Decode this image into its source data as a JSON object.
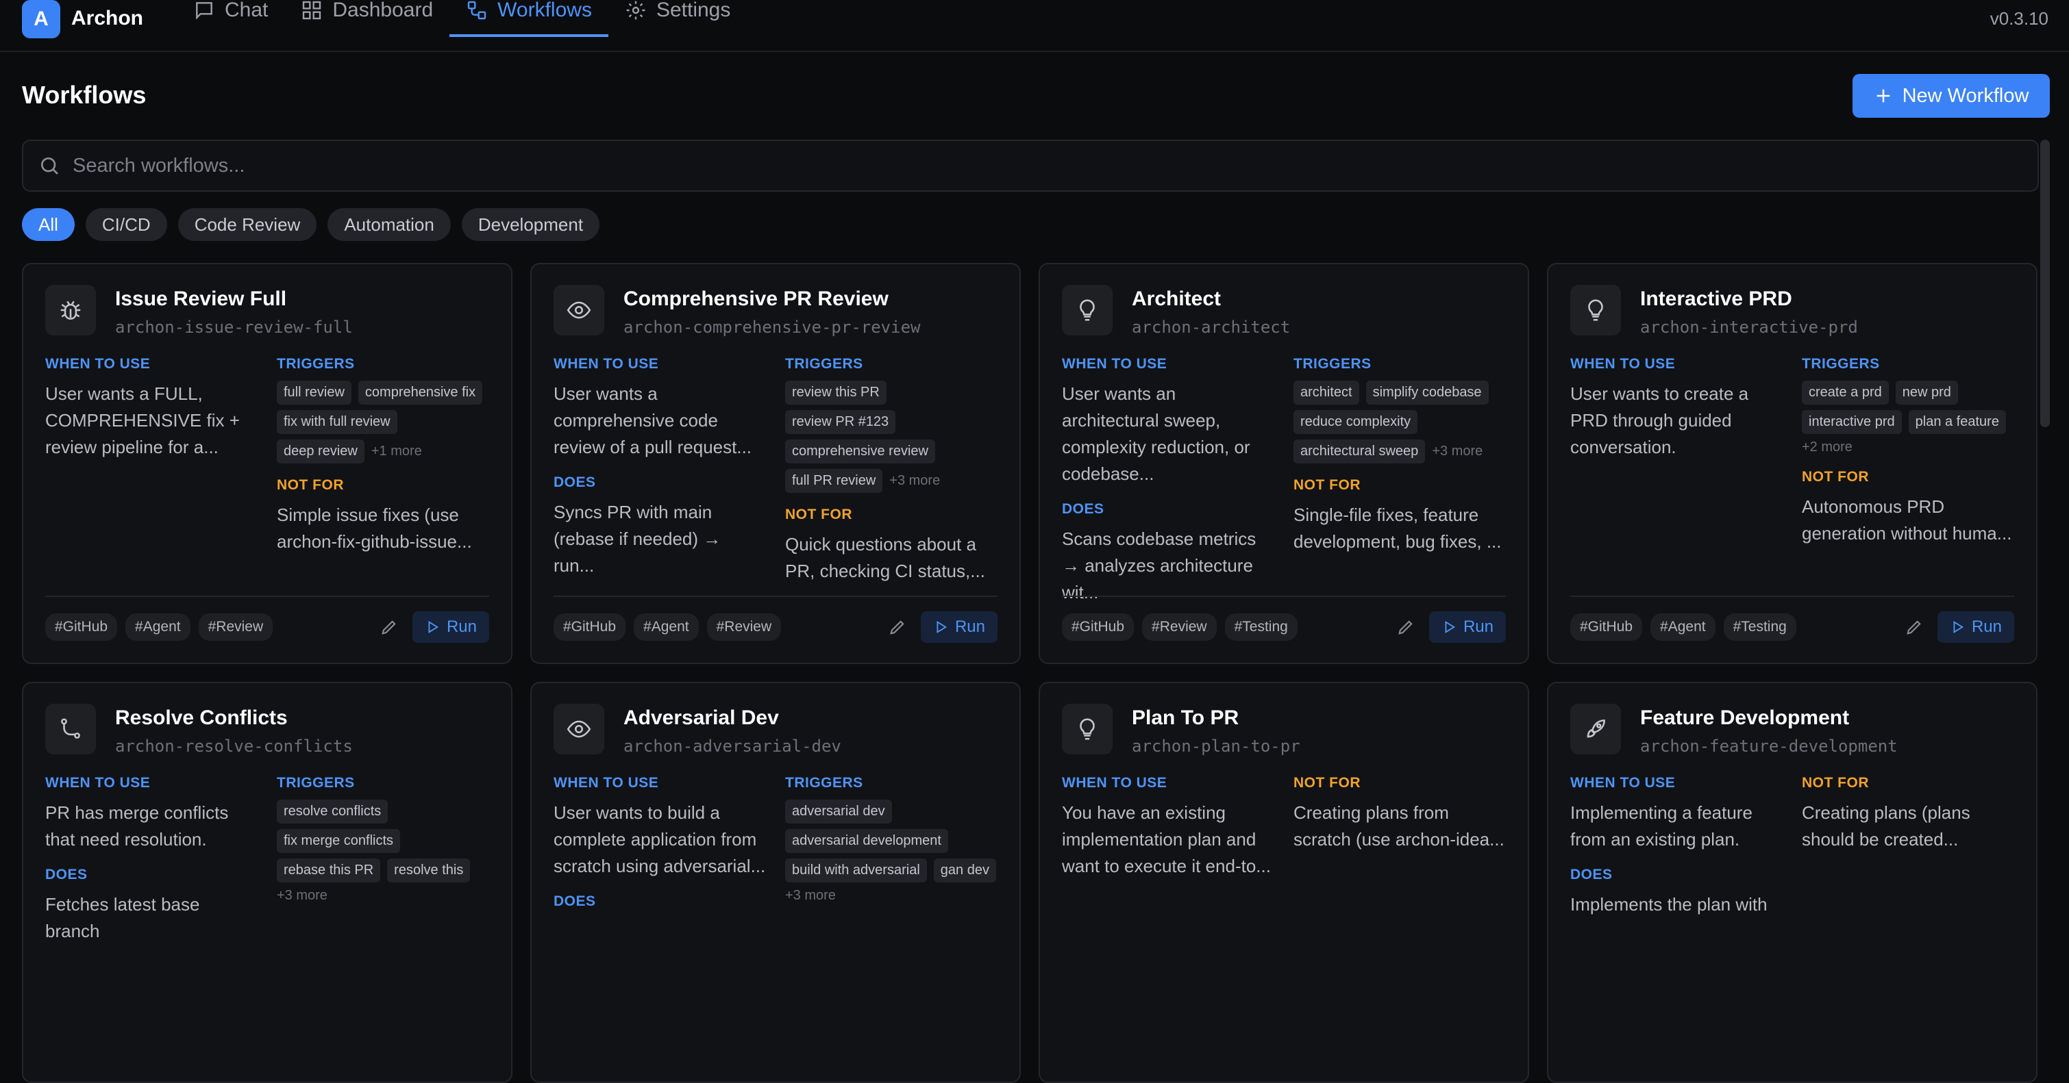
{
  "app": {
    "logo_letter": "A",
    "name": "Archon",
    "version": "v0.3.10"
  },
  "nav": [
    {
      "label": "Chat",
      "icon": "chat-icon",
      "active": false
    },
    {
      "label": "Dashboard",
      "icon": "dashboard-icon",
      "active": false
    },
    {
      "label": "Workflows",
      "icon": "workflow-icon",
      "active": true
    },
    {
      "label": "Settings",
      "icon": "gear-icon",
      "active": false
    }
  ],
  "page": {
    "title": "Workflows",
    "new_button": "New Workflow"
  },
  "search": {
    "placeholder": "Search workflows..."
  },
  "filters": [
    {
      "label": "All",
      "active": true
    },
    {
      "label": "CI/CD",
      "active": false
    },
    {
      "label": "Code Review",
      "active": false
    },
    {
      "label": "Automation",
      "active": false
    },
    {
      "label": "Development",
      "active": false
    }
  ],
  "labels": {
    "when": "WHEN TO USE",
    "triggers": "TRIGGERS",
    "does": "DOES",
    "not_for": "NOT FOR",
    "run": "Run"
  },
  "cards": [
    {
      "title": "Issue Review Full",
      "slug": "archon-issue-review-full",
      "icon": "bug-icon",
      "when": "User wants a FULL, COMPREHENSIVE fix + review pipeline for a...",
      "triggers": [
        "full review",
        "comprehensive fix",
        "fix with full review",
        "deep review"
      ],
      "more": "+1 more",
      "not_for": "Simple issue fixes (use archon-fix-github-issue...",
      "tags": [
        "#GitHub",
        "#Agent",
        "#Review"
      ]
    },
    {
      "title": "Comprehensive PR Review",
      "slug": "archon-comprehensive-pr-review",
      "icon": "eye-icon",
      "when": "User wants a comprehensive code review of a pull request...",
      "does": "Syncs PR with main (rebase if needed) → run...",
      "triggers": [
        "review this PR",
        "review PR #123",
        "comprehensive review",
        "full PR review"
      ],
      "more": "+3 more",
      "not_for": "Quick questions about a PR, checking CI status,...",
      "tags": [
        "#GitHub",
        "#Agent",
        "#Review"
      ]
    },
    {
      "title": "Architect",
      "slug": "archon-architect",
      "icon": "lightbulb-icon",
      "when": "User wants an architectural sweep, complexity reduction, or codebase...",
      "does": "Scans codebase metrics → analyzes architecture wit...",
      "triggers": [
        "architect",
        "simplify codebase",
        "reduce complexity",
        "architectural sweep"
      ],
      "more": "+3 more",
      "not_for": "Single-file fixes, feature development, bug fixes, ...",
      "tags": [
        "#GitHub",
        "#Review",
        "#Testing"
      ]
    },
    {
      "title": "Interactive PRD",
      "slug": "archon-interactive-prd",
      "icon": "lightbulb-icon",
      "when": "User wants to create a PRD through guided conversation.",
      "triggers": [
        "create a prd",
        "new prd",
        "interactive prd",
        "plan a feature"
      ],
      "more": "+2 more",
      "not_for": "Autonomous PRD generation without huma...",
      "tags": [
        "#GitHub",
        "#Agent",
        "#Testing"
      ]
    },
    {
      "title": "Resolve Conflicts",
      "slug": "archon-resolve-conflicts",
      "icon": "git-branch-icon",
      "when": "PR has merge conflicts that need resolution.",
      "does": "Fetches latest base branch",
      "triggers": [
        "resolve conflicts",
        "fix merge conflicts",
        "rebase this PR",
        "resolve this"
      ],
      "more": "+3 more",
      "tags": []
    },
    {
      "title": "Adversarial Dev",
      "slug": "archon-adversarial-dev",
      "icon": "eye-icon",
      "when": "User wants to build a complete application from scratch using adversarial...",
      "does": "",
      "triggers": [
        "adversarial dev",
        "adversarial development",
        "build with adversarial",
        "gan dev"
      ],
      "more": "+3 more",
      "tags": []
    },
    {
      "title": "Plan To PR",
      "slug": "archon-plan-to-pr",
      "icon": "lightbulb-icon",
      "when": "You have an existing implementation plan and want to execute it end-to...",
      "not_for": "Creating plans from scratch (use archon-idea...",
      "tags": []
    },
    {
      "title": "Feature Development",
      "slug": "archon-feature-development",
      "icon": "rocket-icon",
      "when": "Implementing a feature from an existing plan.",
      "does": "Implements the plan with",
      "not_for": "Creating plans (plans should be created...",
      "tags": []
    }
  ]
}
